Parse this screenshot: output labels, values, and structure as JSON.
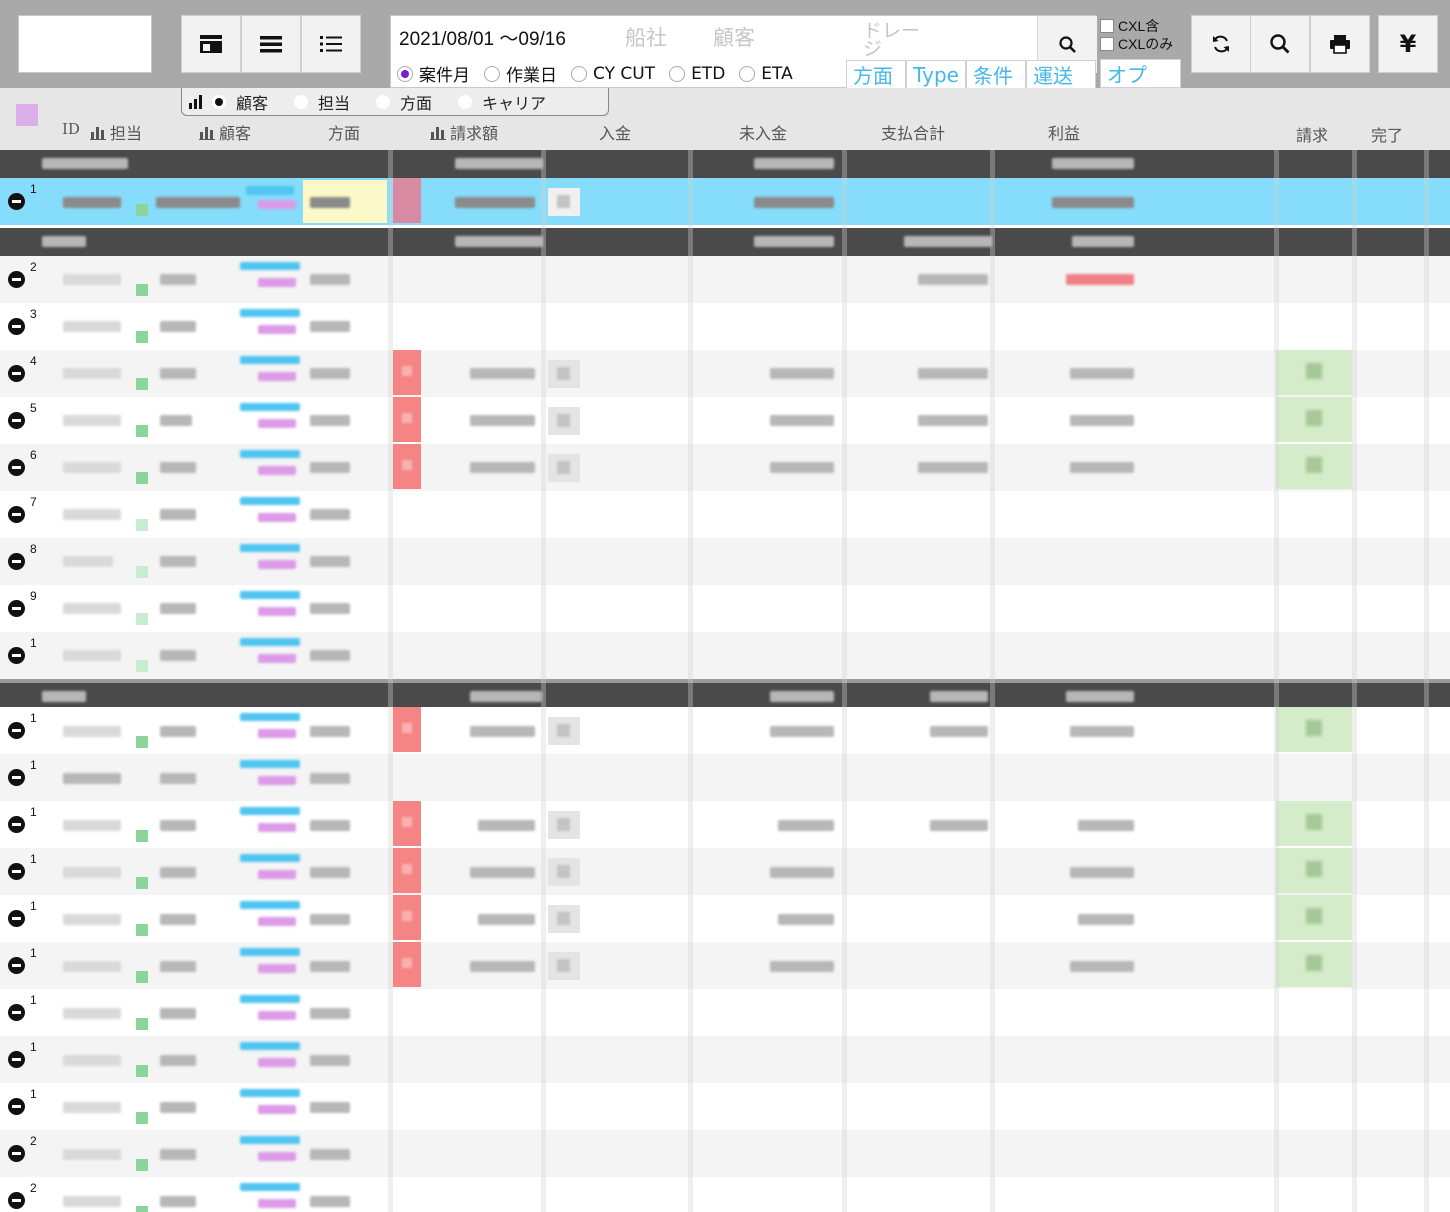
{
  "toolbar": {
    "date_range": "2021/08/01 ～09/16",
    "placeholders": {
      "ship_company": "船社",
      "customer": "顧客",
      "drayage": "ドレージ"
    },
    "date_types": [
      {
        "label": "案件月",
        "selected": true
      },
      {
        "label": "作業日",
        "selected": false
      },
      {
        "label": "CY CUT",
        "selected": false
      },
      {
        "label": "ETD",
        "selected": false
      },
      {
        "label": "ETA",
        "selected": false
      }
    ],
    "filter_tabs": [
      "方面",
      "Type",
      "条件",
      "運送"
    ],
    "option_tab": "オプ",
    "cxl_include": "CXL含",
    "cxl_only": "CXLのみ",
    "view_icons": [
      "layout-header-icon",
      "list-rows-icon",
      "list-bullets-icon"
    ],
    "action_icons": [
      "refresh-icon",
      "search-icon",
      "print-icon",
      "yen-icon"
    ],
    "currency_symbol": "¥"
  },
  "group_by": {
    "options": [
      {
        "label": "顧客",
        "selected": true
      },
      {
        "label": "担当",
        "selected": false
      },
      {
        "label": "方面",
        "selected": false
      },
      {
        "label": "キャリア",
        "selected": false
      }
    ]
  },
  "columns": {
    "id": "ID",
    "staff": "担当",
    "customer": "顧客",
    "direction": "方面",
    "billing": "請求額",
    "received": "入金",
    "unreceived": "未入金",
    "payment_total": "支払合計",
    "profit": "利益",
    "invoice": "請求",
    "done": "完了"
  },
  "rows": {
    "g1": {
      "row1": "1"
    },
    "g2": {
      "row2": "2",
      "row3": "3",
      "row4": "4",
      "row5": "5",
      "row6": "6",
      "row7": "7",
      "row8": "8",
      "row9": "9",
      "row10": "1"
    },
    "g3": {
      "row11": "1",
      "row12": "1",
      "row13": "1",
      "row14": "1",
      "row15": "1",
      "row16": "1",
      "row17": "1",
      "row18": "1",
      "row19": "1",
      "row20": "2",
      "row21": "2"
    }
  },
  "colors": {
    "toolbar_bg": "#a9a9a9",
    "accent": "#45b8e8",
    "selected_row": "#86dcfb",
    "group_header": "#4a4a4a",
    "alert_red": "#f58585",
    "invoice_green": "#d4ecc9"
  }
}
